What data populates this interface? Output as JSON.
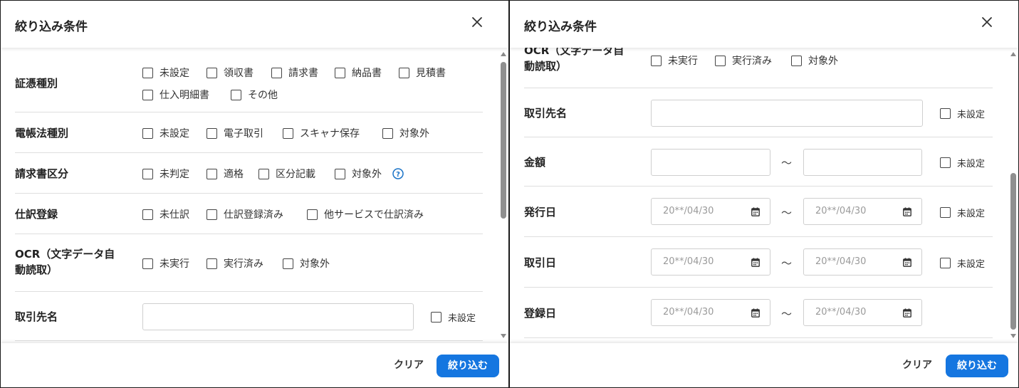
{
  "dialog": {
    "title": "絞り込み条件",
    "clear_label": "クリア",
    "apply_label": "絞り込む"
  },
  "filters": {
    "voucher_type": {
      "label": "証憑種別",
      "options": [
        "未設定",
        "領収書",
        "請求書",
        "納品書",
        "見積書",
        "仕入明細書",
        "その他"
      ]
    },
    "ebook_law_type": {
      "label": "電帳法種別",
      "options": [
        "未設定",
        "電子取引",
        "スキャナ保存",
        "対象外"
      ]
    },
    "invoice_category": {
      "label": "請求書区分",
      "options": [
        "未判定",
        "適格",
        "区分記載",
        "対象外"
      ]
    },
    "journal_registration": {
      "label": "仕訳登録",
      "options": [
        "未仕訳",
        "仕訳登録済み",
        "他サービスで仕訳済み"
      ]
    },
    "ocr": {
      "label_line1": "OCR（文字データ自",
      "label_line2": "動読取）",
      "options": [
        "未実行",
        "実行済み",
        "対象外"
      ]
    },
    "partner_name": {
      "label": "取引先名",
      "unset_label": "未設定"
    },
    "amount": {
      "label": "金額",
      "unset_label": "未設定"
    },
    "issue_date": {
      "label": "発行日",
      "unset_label": "未設定",
      "from_placeholder": "20**/04/30",
      "to_placeholder": "20**/04/30"
    },
    "transaction_date": {
      "label": "取引日",
      "unset_label": "未設定",
      "from_placeholder": "20**/04/30",
      "to_placeholder": "20**/04/30"
    },
    "registration_date": {
      "label": "登録日",
      "from_placeholder": "20**/04/30",
      "to_placeholder": "20**/04/30"
    },
    "range_separator": "〜"
  },
  "icons": {
    "close": "close-icon",
    "help": "help-icon",
    "calendar": "calendar-icon"
  },
  "colors": {
    "primary": "#1576e0",
    "help": "#1a73c7"
  },
  "scroll_position": {
    "left_panel": 0.0,
    "right_panel": 0.55
  }
}
